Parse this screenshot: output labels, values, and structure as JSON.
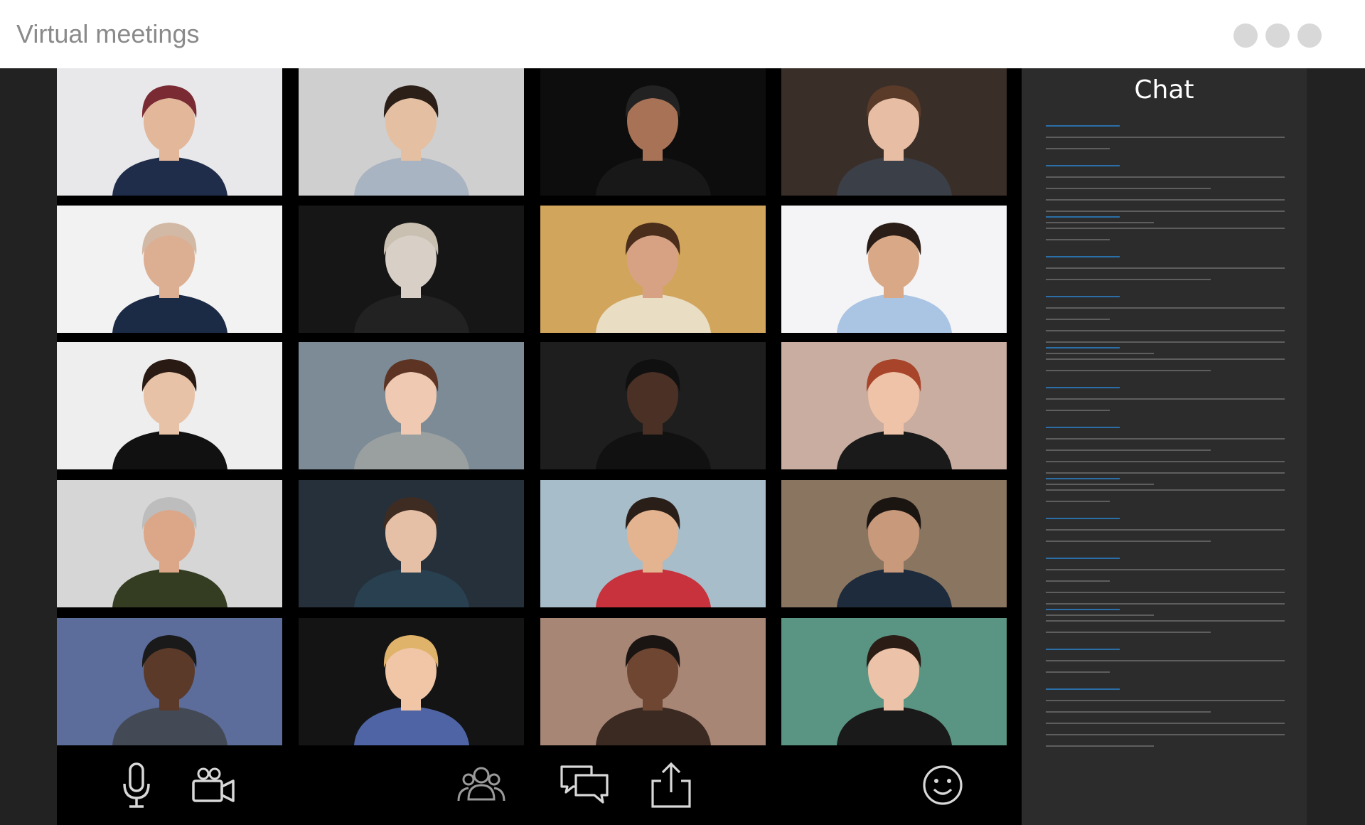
{
  "window": {
    "title": "Virtual meetings",
    "controls": [
      "window-dot",
      "window-dot",
      "window-dot"
    ]
  },
  "participants": [
    {
      "icon": "participant-video",
      "bg": "#e8e8ea",
      "skin": "#e2b79a",
      "hair": "#7a2a33",
      "shirt": "#1f2d4a"
    },
    {
      "icon": "participant-video",
      "bg": "#cfcfcf",
      "skin": "#e4bfa2",
      "hair": "#2b1f18",
      "shirt": "#a9b4c2"
    },
    {
      "icon": "participant-video",
      "bg": "#0d0d0d",
      "skin": "#a87256",
      "hair": "#222222",
      "shirt": "#181818"
    },
    {
      "icon": "participant-video",
      "bg": "#3a2e28",
      "skin": "#e7bda4",
      "hair": "#5a3a28",
      "shirt": "#3b3f47"
    },
    {
      "icon": "participant-video",
      "bg": "#f2f2f2",
      "skin": "#dcae92",
      "hair": "#d2b9a6",
      "shirt": "#1b2a45"
    },
    {
      "icon": "participant-video",
      "bg": "#161616",
      "skin": "#d8d0c6",
      "hair": "#c9c0b2",
      "shirt": "#222222"
    },
    {
      "icon": "participant-video",
      "bg": "#d2a55c",
      "skin": "#d7a283",
      "hair": "#4a2d1a",
      "shirt": "#e9ddc4"
    },
    {
      "icon": "participant-video",
      "bg": "#f4f4f6",
      "skin": "#d9a987",
      "hair": "#2a1d17",
      "shirt": "#aac4e3"
    },
    {
      "icon": "participant-video",
      "bg": "#eeeeee",
      "skin": "#e8c2a6",
      "hair": "#2a1a14",
      "shirt": "#111111"
    },
    {
      "icon": "participant-video",
      "bg": "#7c8b96",
      "skin": "#efc9b1",
      "hair": "#5d3424",
      "shirt": "#9aa0a0"
    },
    {
      "icon": "participant-video",
      "bg": "#1e1e1e",
      "skin": "#4a3025",
      "hair": "#101010",
      "shirt": "#111111"
    },
    {
      "icon": "participant-video",
      "bg": "#c9ada0",
      "skin": "#efc3a7",
      "hair": "#a8442a",
      "shirt": "#1a1a1a"
    },
    {
      "icon": "participant-video",
      "bg": "#d6d6d6",
      "skin": "#dca788",
      "hair": "#bdbdbd",
      "shirt": "#343d22"
    },
    {
      "icon": "participant-video",
      "bg": "#25303a",
      "skin": "#e6c0a6",
      "hair": "#3e2c22",
      "shirt": "#28404f"
    },
    {
      "icon": "participant-video",
      "bg": "#a7bdc9",
      "skin": "#e3b48f",
      "hair": "#2a1e18",
      "shirt": "#c8323c"
    },
    {
      "icon": "participant-video",
      "bg": "#8a7560",
      "skin": "#c9997c",
      "hair": "#1b1512",
      "shirt": "#1d2b3c"
    },
    {
      "icon": "participant-video",
      "bg": "#5c6d9c",
      "skin": "#5b3a2a",
      "hair": "#1a1a1a",
      "shirt": "#444a55"
    },
    {
      "icon": "participant-video",
      "bg": "#141414",
      "skin": "#f0c6a7",
      "hair": "#e0b36b",
      "shirt": "#4e64a4"
    },
    {
      "icon": "participant-video",
      "bg": "#a88676",
      "skin": "#6e4632",
      "hair": "#1a1412",
      "shirt": "#3b2a22"
    },
    {
      "icon": "participant-video",
      "bg": "#5a9482",
      "skin": "#ecc3a8",
      "hair": "#2b1c16",
      "shirt": "#1a1a1a"
    }
  ],
  "toolbar": {
    "buttons": [
      {
        "icon": "microphone-icon"
      },
      {
        "icon": "video-camera-icon"
      },
      {
        "icon": "participants-icon"
      },
      {
        "icon": "chat-bubbles-icon"
      },
      {
        "icon": "share-screen-icon"
      },
      {
        "icon": "reactions-smiley-icon"
      }
    ]
  },
  "chat": {
    "title": "Chat",
    "message_count": 14
  },
  "colors": {
    "title_bar": "#ffffff",
    "title_text": "#8a8a8a",
    "background": "#232323",
    "grid_background": "#000000",
    "chat_panel": "#2c2c2c",
    "chat_name_line": "#2b6fa8",
    "chat_text_line": "#5e5e5e",
    "icon_color": "#d8d8d8"
  }
}
